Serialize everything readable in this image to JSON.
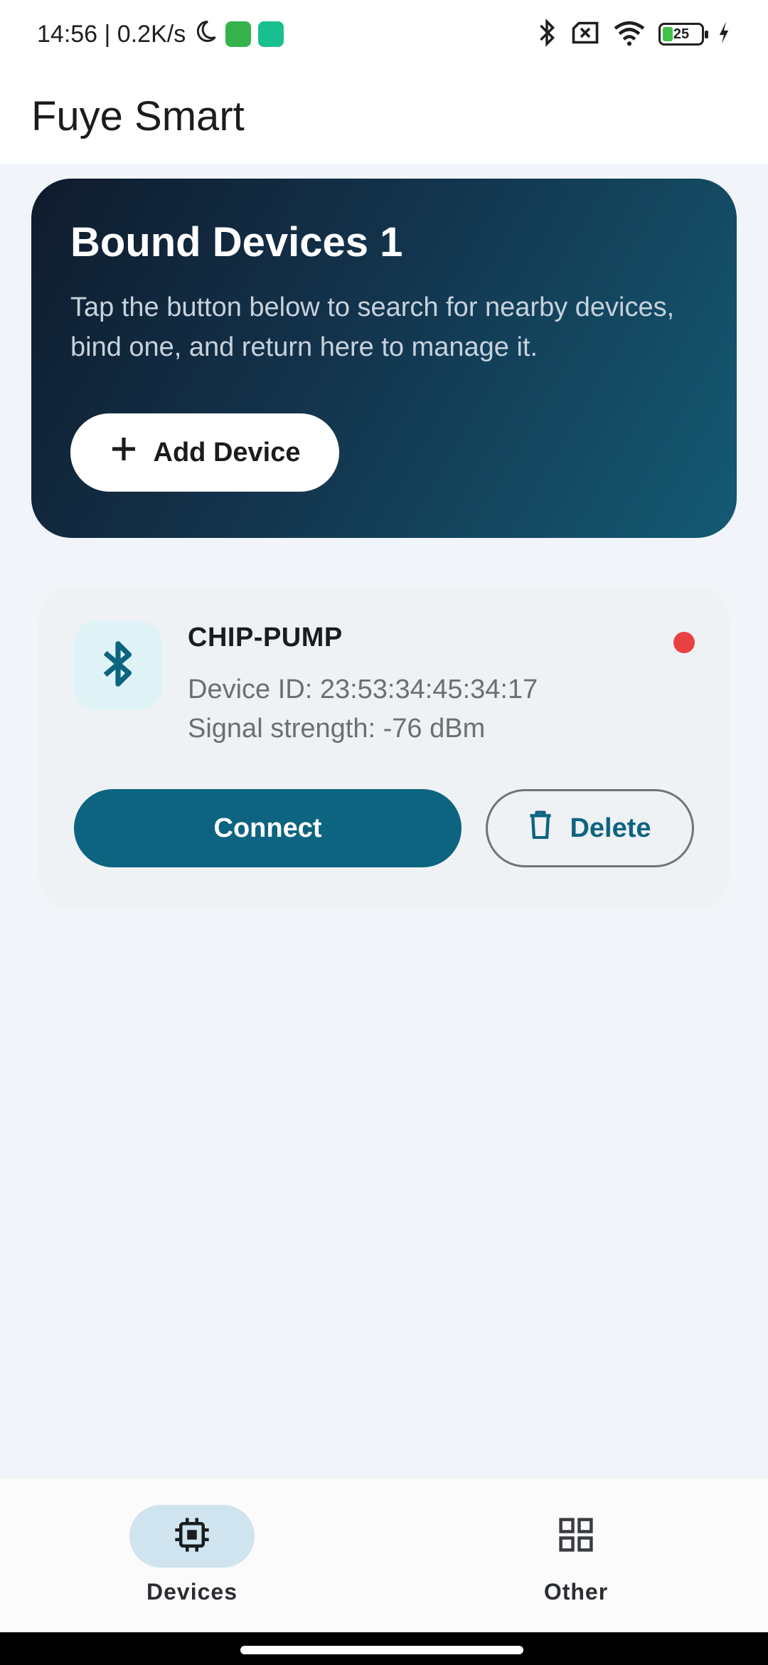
{
  "status_bar": {
    "time_speed": "14:56 | 0.2K/s",
    "battery_level": "25"
  },
  "app_bar": {
    "title": "Fuye Smart"
  },
  "hero": {
    "title": "Bound Devices 1",
    "description": "Tap the button below to search for nearby devices, bind one, and return here to manage it.",
    "add_button_label": "Add Device"
  },
  "device": {
    "name": "CHIP-PUMP",
    "device_id": "Device ID: 23:53:34:45:34:17",
    "signal": "Signal strength: -76 dBm",
    "status_color": "#e84142",
    "connect_label": "Connect",
    "delete_label": "Delete"
  },
  "bottom_nav": {
    "items": [
      {
        "label": "Devices",
        "icon": "chip-icon",
        "active": true
      },
      {
        "label": "Other",
        "icon": "grid-icon",
        "active": false
      }
    ]
  },
  "colors": {
    "primary": "#0d6480",
    "hero_gradient_start": "#0f1b2c",
    "hero_gradient_end": "#145a73",
    "background": "#f1f5f9"
  }
}
